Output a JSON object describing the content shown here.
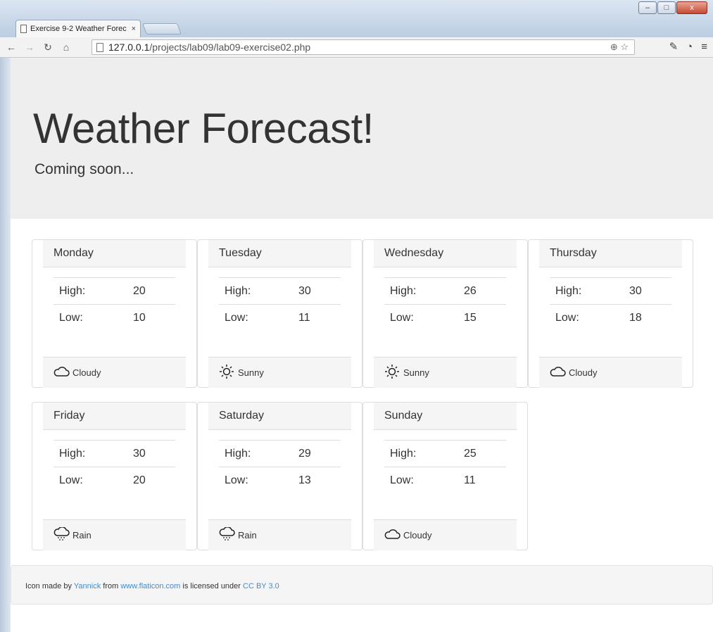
{
  "window": {
    "tab_title": "Exercise 9-2 Weather Forec",
    "tab_close": "×",
    "url_host": "127.0.0.1",
    "url_path": "/projects/lab09/lab09-exercise02.php",
    "min": "–",
    "max": "□",
    "close": "x"
  },
  "header": {
    "title": "Weather Forecast!",
    "subtitle": "Coming soon..."
  },
  "forecast": [
    {
      "day": "Monday",
      "high_label": "High:",
      "high": "20",
      "low_label": "Low:",
      "low": "10",
      "condition": "Cloudy",
      "icon": "cloud-icon"
    },
    {
      "day": "Tuesday",
      "high_label": "High:",
      "high": "30",
      "low_label": "Low:",
      "low": "11",
      "condition": "Sunny",
      "icon": "sun-icon"
    },
    {
      "day": "Wednesday",
      "high_label": "High:",
      "high": "26",
      "low_label": "Low:",
      "low": "15",
      "condition": "Sunny",
      "icon": "sun-icon"
    },
    {
      "day": "Thursday",
      "high_label": "High:",
      "high": "30",
      "low_label": "Low:",
      "low": "18",
      "condition": "Cloudy",
      "icon": "cloud-icon"
    },
    {
      "day": "Friday",
      "high_label": "High:",
      "high": "30",
      "low_label": "Low:",
      "low": "20",
      "condition": "Rain",
      "icon": "rain-icon"
    },
    {
      "day": "Saturday",
      "high_label": "High:",
      "high": "29",
      "low_label": "Low:",
      "low": "13",
      "condition": "Rain",
      "icon": "rain-icon"
    },
    {
      "day": "Sunday",
      "high_label": "High:",
      "high": "25",
      "low_label": "Low:",
      "low": "11",
      "condition": "Cloudy",
      "icon": "cloud-icon"
    }
  ],
  "footer": {
    "prefix": "Icon made by ",
    "author": "Yannick",
    "from": " from ",
    "site": "www.flaticon.com",
    "licensed": " is licensed under ",
    "license": "CC BY 3.0"
  },
  "colors": {
    "link": "#428bca",
    "jumbotron_bg": "#eeeeee",
    "panel_bg": "#f5f5f5"
  }
}
